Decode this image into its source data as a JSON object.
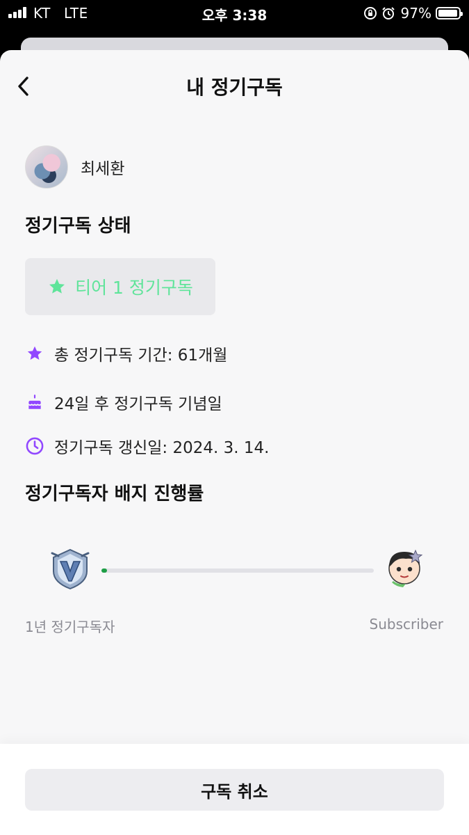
{
  "status_bar": {
    "carrier": "KT",
    "network": "LTE",
    "time": "오후 3:38",
    "battery_percent_label": "97%",
    "battery_level": 0.97,
    "icons": [
      "signal-bars-icon",
      "orientation-lock-icon",
      "alarm-icon",
      "battery-icon"
    ]
  },
  "header": {
    "title": "내 정기구독",
    "back_icon": "chevron-left-icon"
  },
  "profile": {
    "name": "최세환"
  },
  "subscription_status": {
    "title": "정기구독 상태",
    "tier_label": "티어 1 정기구독",
    "tier_icon": "star-icon",
    "tier_color": "#5fe49a"
  },
  "info": {
    "total_period": "총 정기구독 기간: 61개월",
    "anniversary": "24일 후 정기구독 기념일",
    "renewal_date": "정기구독 갱신일: 2024. 3. 14.",
    "icon_color": "#9147ff"
  },
  "badge_progress": {
    "title": "정기구독자 배지 진행률",
    "current_badge_label": "1년 정기구독자",
    "next_badge_label": "Subscriber",
    "progress_fraction": 0.02,
    "progress_color": "#1e9e46"
  },
  "footer": {
    "cancel_label": "구독 취소"
  }
}
